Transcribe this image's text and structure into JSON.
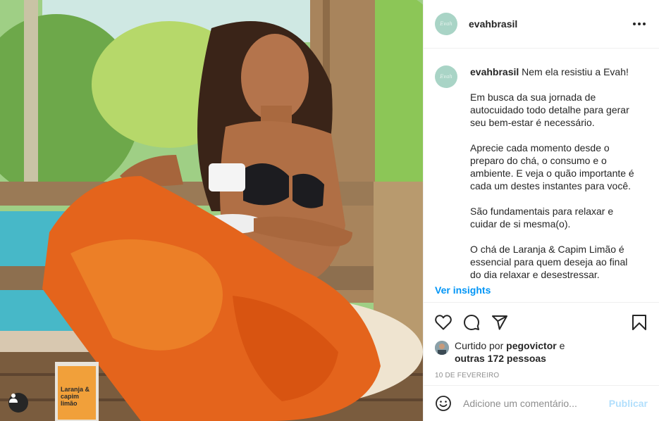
{
  "post": {
    "username": "evahbrasil",
    "avatar_text": "Evah",
    "caption_paragraphs": [
      "Nem ela resistiu a Evah!",
      "Em busca da sua jornada de autocuidado todo detalhe para gerar seu bem-estar é necessário.",
      "Aprecie cada momento desde o preparo do chá, o consumo e o ambiente. E veja o quão importante é cada um destes instantes para você.",
      "São fundamentais para relaxar e cuidar de si mesma(o).",
      "O chá de Laranja & Capim Limão é essencial para quem deseja ao final do dia relaxar e desestressar."
    ],
    "product_label": "Laranja & capim limão",
    "insights_label": "Ver insights",
    "likes": {
      "prefix": "Curtido por",
      "user": "pegovictor",
      "connector": "e",
      "others": "outras 172 pessoas"
    },
    "date": "10 DE FEVEREIRO",
    "comment_placeholder": "Adicione um comentário...",
    "publish_label": "Publicar"
  },
  "icons": [
    "user-tag-icon",
    "more-options-icon",
    "heart-icon",
    "comment-icon",
    "share-icon",
    "bookmark-icon",
    "emoji-icon"
  ],
  "colors": {
    "link": "#0095f6",
    "publish_disabled": "#b2dffc",
    "avatar": "#a9d4c6",
    "muted": "#8e8e8e"
  }
}
